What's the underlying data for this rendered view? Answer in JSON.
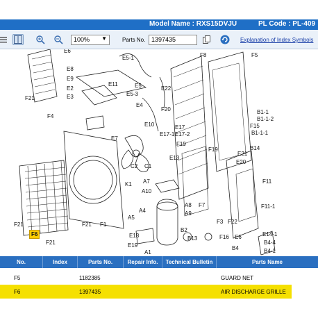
{
  "header": {
    "model_name": "Model Name : RXS15DVJU",
    "pl_code": "PL Code : PL-409"
  },
  "toolbar": {
    "zoom_value": "100%",
    "parts_no_label": "Parts No.",
    "parts_no_value": "1397435",
    "explanation_link": "Explanation of Index Symbols"
  },
  "diagram": {
    "labels": [
      "E6",
      "E8",
      "E9",
      "E2",
      "E3",
      "E5-1",
      "E5",
      "E11",
      "E5-3",
      "E22",
      "E4",
      "F8",
      "F5",
      "F21",
      "F4",
      "F20",
      "B1-1",
      "B1-1-2",
      "F15",
      "B1-1-1",
      "E10",
      "E7",
      "E17-1",
      "E17",
      "E17-2",
      "F19",
      "B14",
      "E13",
      "F19",
      "E21",
      "E20",
      "C2",
      "C1",
      "K1",
      "A7",
      "A10",
      "F11",
      "A8",
      "A9",
      "F7",
      "F11-1",
      "F21",
      "A4",
      "A5",
      "F21",
      "F1",
      "F3",
      "F22",
      "F6",
      "F21",
      "E18",
      "B2",
      "B13",
      "F16",
      "E6",
      "E14-1",
      "B4-4",
      "E19",
      "B4",
      "B4-1",
      "A1"
    ],
    "selected_label": "F6"
  },
  "table": {
    "columns": [
      "No.",
      "Index",
      "Parts No.",
      "Repair Info.",
      "Technical Bulletin",
      "Parts Name"
    ],
    "rows": [
      {
        "no": "F5",
        "index": "",
        "parts_no": "1182385",
        "repair": "",
        "bulletin": "",
        "name": "GUARD NET"
      },
      {
        "no": "F6",
        "index": "",
        "parts_no": "1397435",
        "repair": "",
        "bulletin": "",
        "name": "AIR DISCHARGE GRILLE"
      }
    ]
  },
  "colors": {
    "header_blue": "#1f6fc6",
    "table_head_blue": "#2a6fc0",
    "selected_row": "#f5e000",
    "highlight_label": "#ffcc00"
  }
}
